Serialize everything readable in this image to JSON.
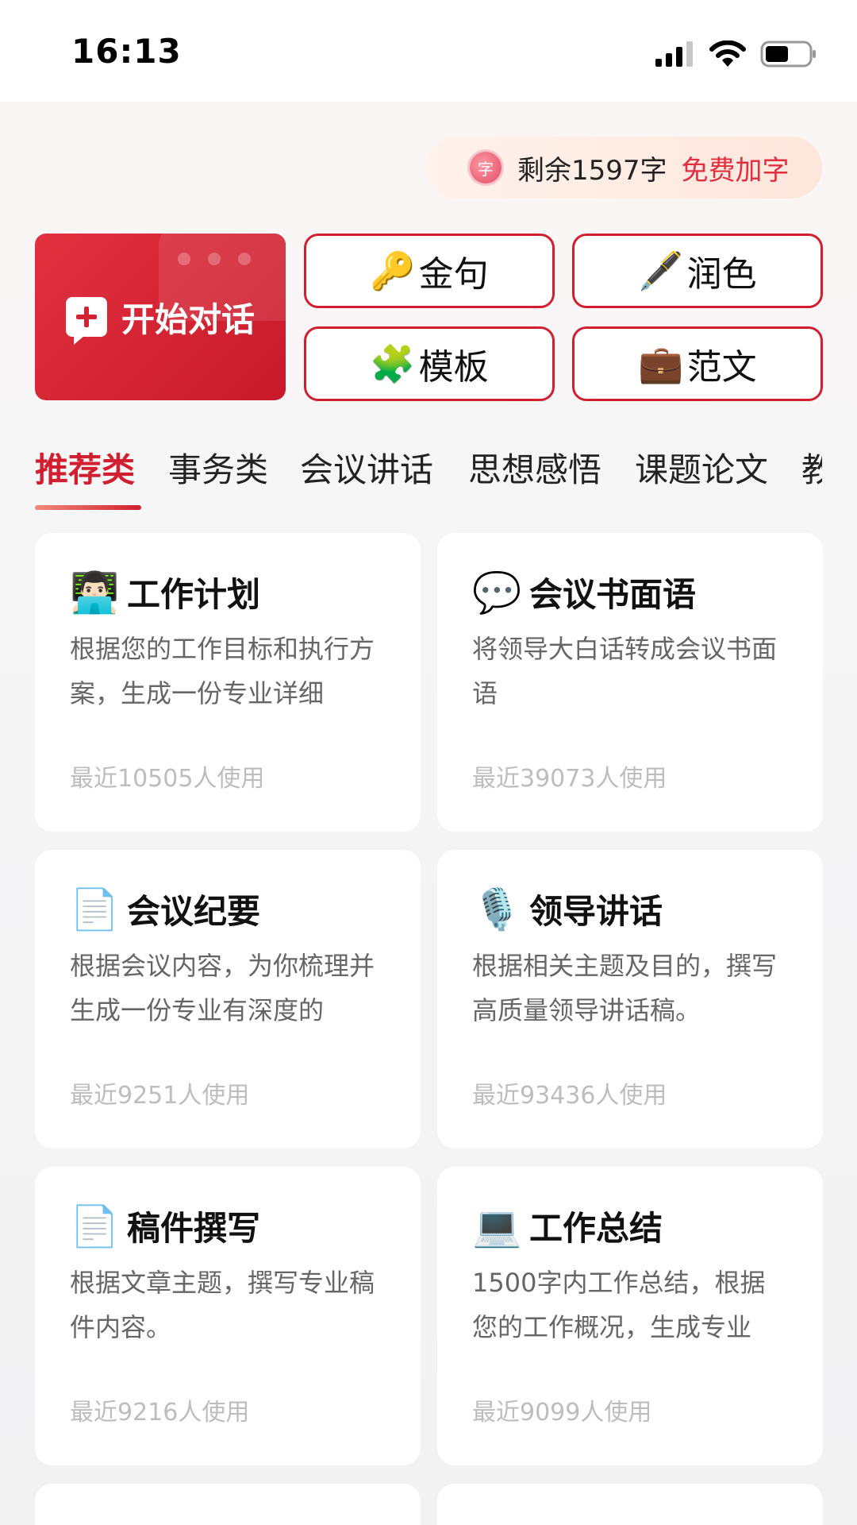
{
  "status_bar": {
    "time": "16:13"
  },
  "quota": {
    "badge": "字",
    "remaining": "剩余1597字",
    "action": "免费加字"
  },
  "start_chat": {
    "label": "开始对话"
  },
  "quick_actions": [
    {
      "icon": "🔑",
      "label": "金句"
    },
    {
      "icon": "🖋️",
      "label": "润色"
    },
    {
      "icon": "🧩",
      "label": "模板"
    },
    {
      "icon": "💼",
      "label": "范文"
    }
  ],
  "tabs": [
    "推荐类",
    "事务类",
    "会议讲话",
    "思想感悟",
    "课题论文",
    "教"
  ],
  "cards": [
    {
      "icon": "👨🏻‍💻",
      "title": "工作计划",
      "desc": "根据您的工作目标和执行方案，生成一份专业详细",
      "usage": "最近10505人使用"
    },
    {
      "icon": "💬",
      "title": "会议书面语",
      "desc": "将领导大白话转成会议书面语",
      "usage": "最近39073人使用"
    },
    {
      "icon": "📄",
      "title": "会议纪要",
      "desc": "根据会议内容，为你梳理并生成一份专业有深度的",
      "usage": "最近9251人使用"
    },
    {
      "icon": "🎙️",
      "title": "领导讲话",
      "desc": "根据相关主题及目的，撰写高质量领导讲话稿。",
      "usage": "最近93436人使用"
    },
    {
      "icon": "📄",
      "title": "稿件撰写",
      "desc": "根据文章主题，撰写专业稿件内容。",
      "usage": "最近9216人使用"
    },
    {
      "icon": "💻",
      "title": "工作总结",
      "desc": "1500字内工作总结，根据您的工作概况，生成专业",
      "usage": "最近9099人使用"
    }
  ]
}
